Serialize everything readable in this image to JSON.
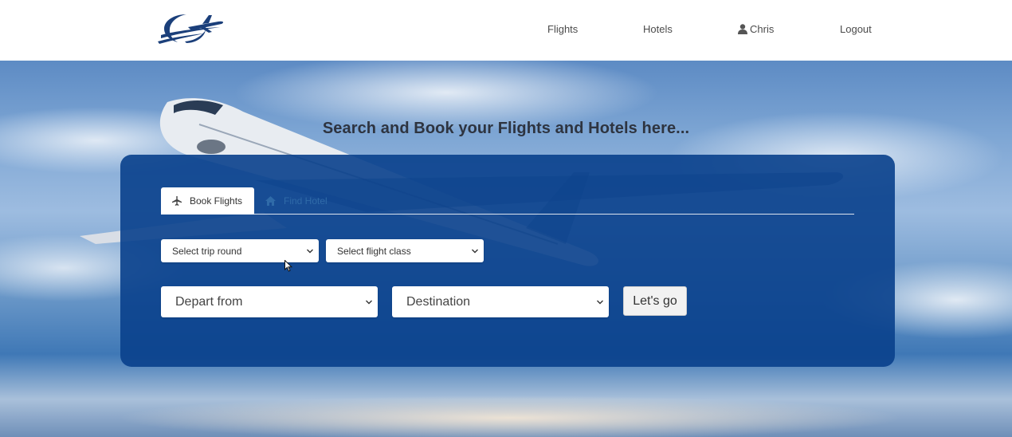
{
  "nav": {
    "flights_label": "Flights",
    "hotels_label": "Hotels",
    "user_name": "Chris",
    "logout_label": "Logout"
  },
  "hero": {
    "title": "Search and Book your Flights and Hotels here..."
  },
  "search": {
    "tabs": [
      {
        "label": "Book Flights",
        "icon": "airplane-icon",
        "active": true
      },
      {
        "label": "Find Hotel",
        "icon": "home-icon",
        "active": false
      }
    ],
    "trip_round_placeholder": "Select trip round",
    "flight_class_placeholder": "Select flight class",
    "depart_placeholder": "Depart from",
    "destination_placeholder": "Destination",
    "submit_label": "Let's go"
  },
  "colors": {
    "panel": "#09408c",
    "brand_blue": "#1b3f7a",
    "header_bg": "#ffffff"
  }
}
